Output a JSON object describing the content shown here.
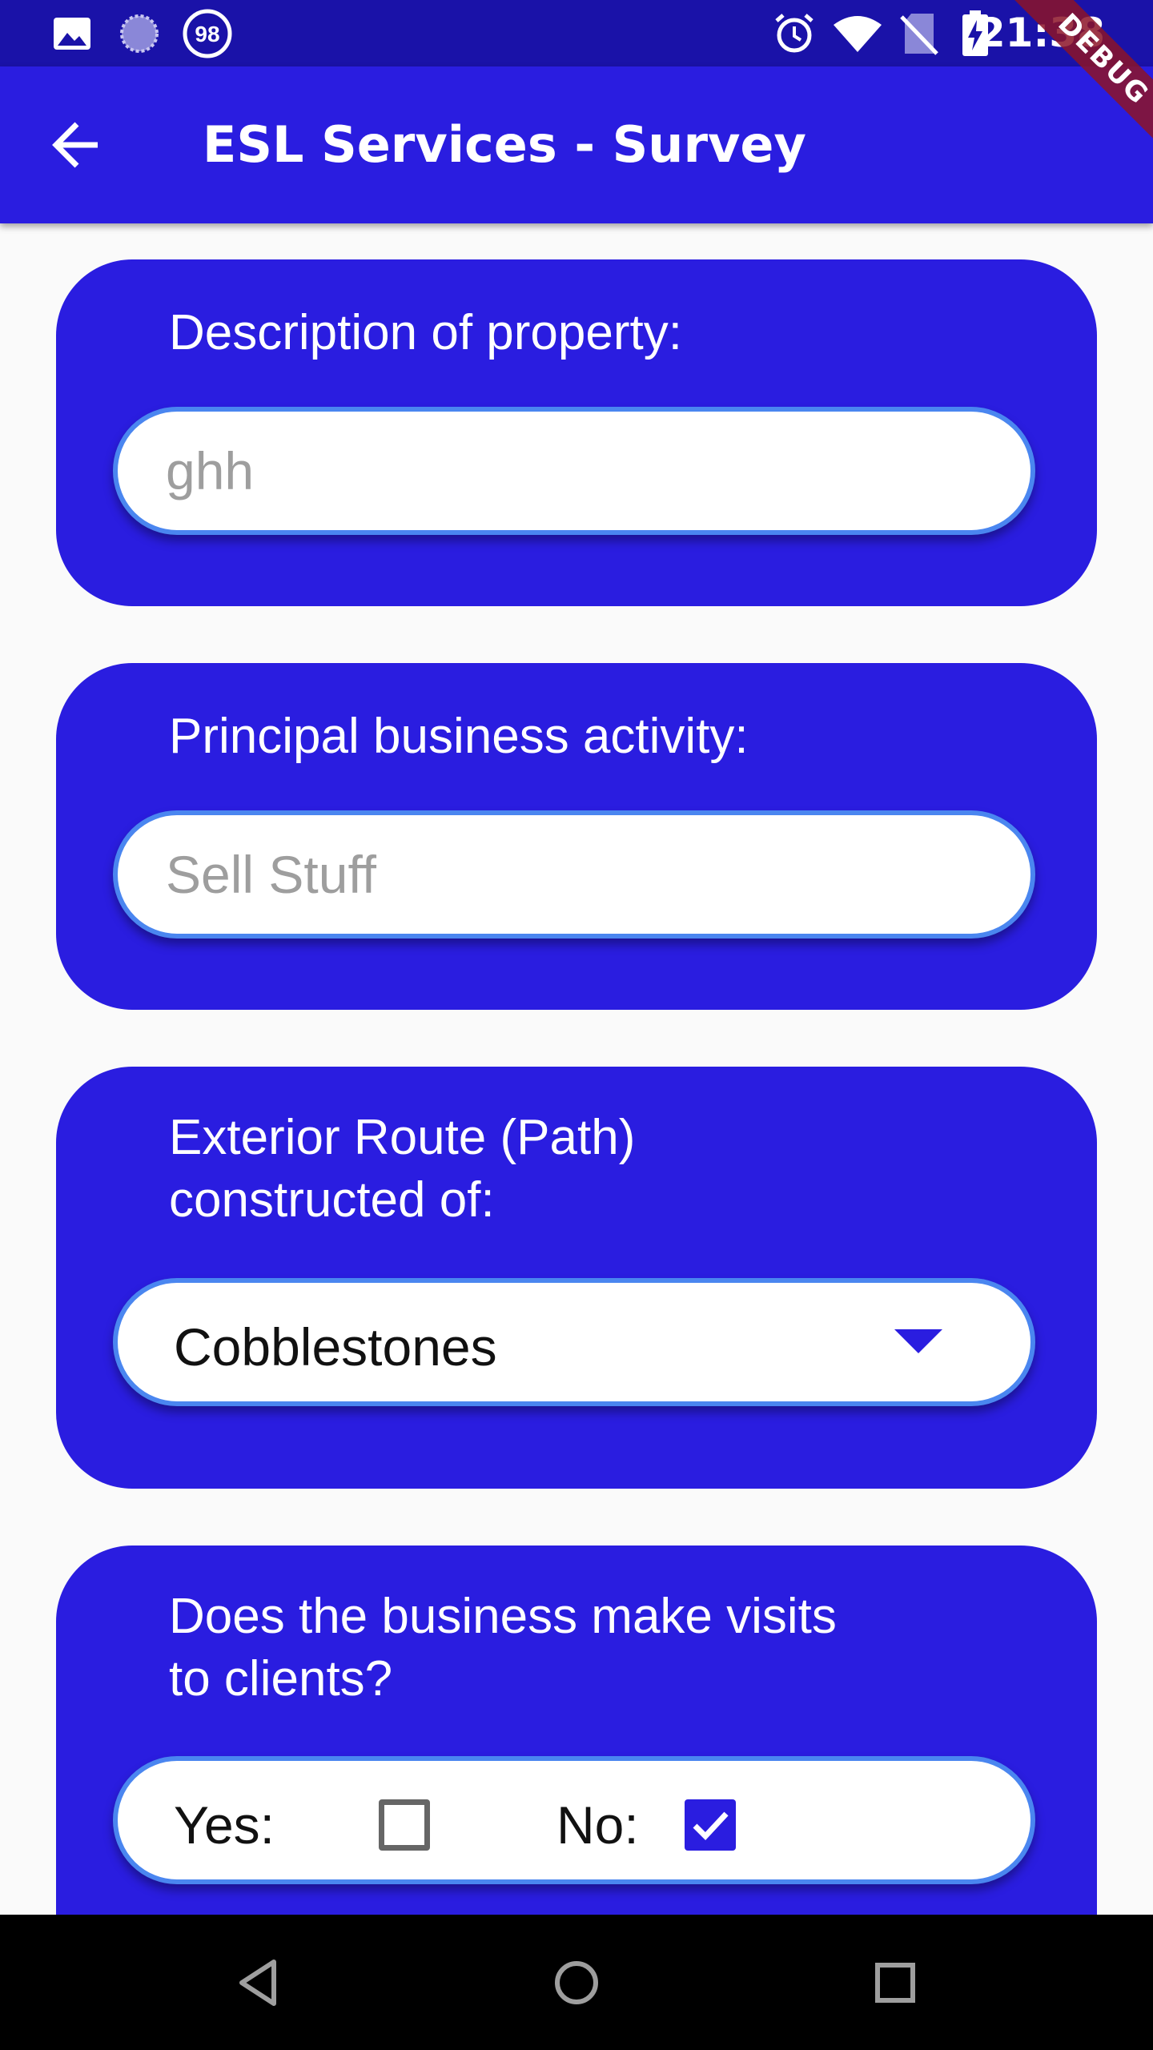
{
  "status_bar": {
    "time": "21:38",
    "left_icons": [
      "image-icon",
      "sync-progress-icon",
      "badge-98-icon"
    ],
    "badge_text": "98",
    "right_icons": [
      "alarm-icon",
      "wifi-icon",
      "no-sim-icon",
      "battery-charging-icon"
    ]
  },
  "app_bar": {
    "title": "ESL Services - Survey",
    "back_icon": "arrow-back-icon"
  },
  "debug_banner": "DEBUG",
  "colors": {
    "primary": "#2a1de0",
    "status_bar": "#1a12a8",
    "field_border": "#4a86f0",
    "background": "#fafafa"
  },
  "form": {
    "description": {
      "label": "Description of property:",
      "value": "ghh"
    },
    "business_activity": {
      "label": "Principal business activity:",
      "value": "Sell Stuff"
    },
    "exterior_route": {
      "label_line1": "Exterior Route (Path)",
      "label_line2": "constructed of:",
      "selected": "Cobblestones"
    },
    "visits": {
      "label_line1": "Does the business make visits",
      "label_line2": "to clients?",
      "yes_label": "Yes:",
      "yes_checked": false,
      "no_label": "No:",
      "no_checked": true
    }
  },
  "nav_bar": {
    "buttons": [
      "back-triangle-icon",
      "home-circle-icon",
      "recents-square-icon"
    ]
  }
}
